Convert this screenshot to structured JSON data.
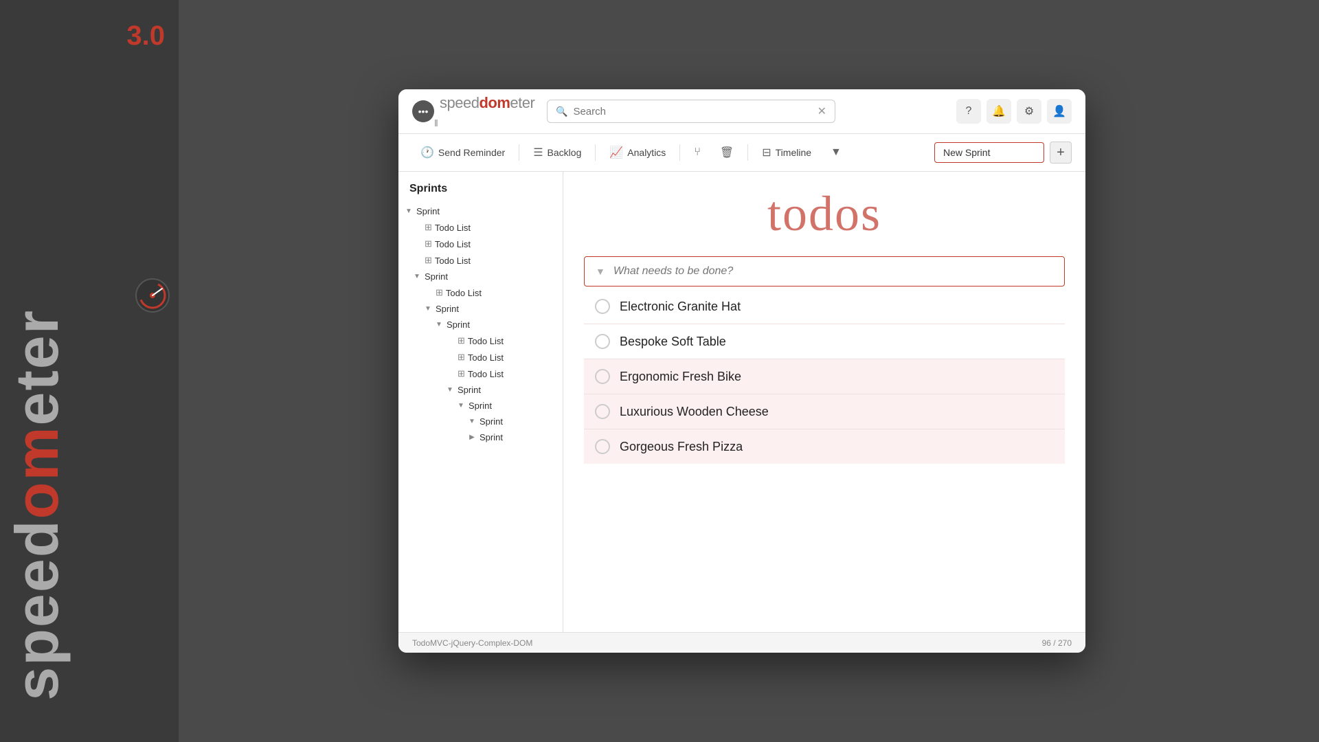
{
  "background": {
    "speedometer_label": "speedometer 3.0",
    "version": "3.0"
  },
  "logo": {
    "text_speed": "speed",
    "text_dom": "dom",
    "text_eter": "eter",
    "icon_symbol": "•••",
    "pause_symbol": "‖"
  },
  "header": {
    "search_placeholder": "Search",
    "search_value": "",
    "icons": {
      "help": "?",
      "notification": "🔔",
      "settings": "⚙",
      "user": "👤"
    }
  },
  "toolbar": {
    "send_reminder": "Send Reminder",
    "backlog": "Backlog",
    "analytics": "Analytics",
    "timeline": "Timeline",
    "filter_icon": "▼",
    "new_sprint_value": "New Sprint",
    "add_symbol": "+"
  },
  "sidebar": {
    "title": "Sprints",
    "tree": [
      {
        "label": "Sprint",
        "type": "sprint",
        "level": 0,
        "expanded": true,
        "icon": "chevron-down"
      },
      {
        "label": "Todo List",
        "type": "todo",
        "level": 1,
        "icon": "grid"
      },
      {
        "label": "Todo List",
        "type": "todo",
        "level": 1,
        "icon": "grid"
      },
      {
        "label": "Todo List",
        "type": "todo",
        "level": 1,
        "icon": "grid"
      },
      {
        "label": "Sprint",
        "type": "sprint",
        "level": 1,
        "expanded": true,
        "icon": "chevron-down"
      },
      {
        "label": "Todo List",
        "type": "todo",
        "level": 2,
        "icon": "grid"
      },
      {
        "label": "Sprint",
        "type": "sprint",
        "level": 2,
        "expanded": true,
        "icon": "chevron-down"
      },
      {
        "label": "Sprint",
        "type": "sprint",
        "level": 3,
        "expanded": true,
        "icon": "chevron-down"
      },
      {
        "label": "Todo List",
        "type": "todo",
        "level": 4,
        "icon": "grid"
      },
      {
        "label": "Todo List",
        "type": "todo",
        "level": 4,
        "icon": "grid"
      },
      {
        "label": "Todo List",
        "type": "todo",
        "level": 4,
        "icon": "grid"
      },
      {
        "label": "Sprint",
        "type": "sprint",
        "level": 4,
        "expanded": true,
        "icon": "chevron-down"
      },
      {
        "label": "Sprint",
        "type": "sprint",
        "level": 5,
        "expanded": true,
        "icon": "chevron-down"
      },
      {
        "label": "Sprint",
        "type": "sprint",
        "level": 6,
        "expanded": true,
        "icon": "chevron-down"
      },
      {
        "label": "Sprint",
        "type": "sprint",
        "level": 6,
        "collapsed": true,
        "icon": "chevron-right"
      }
    ]
  },
  "todo": {
    "title": "todos",
    "input_placeholder": "What needs to be done?",
    "items": [
      {
        "text": "Electronic Granite Hat",
        "highlighted": false
      },
      {
        "text": "Bespoke Soft Table",
        "highlighted": false
      },
      {
        "text": "Ergonomic Fresh Bike",
        "highlighted": true
      },
      {
        "text": "Luxurious Wooden Cheese",
        "highlighted": true
      },
      {
        "text": "Gorgeous Fresh Pizza",
        "highlighted": true
      }
    ]
  },
  "status_bar": {
    "framework": "TodoMVC-jQuery-Complex-DOM",
    "count": "96 / 270"
  }
}
